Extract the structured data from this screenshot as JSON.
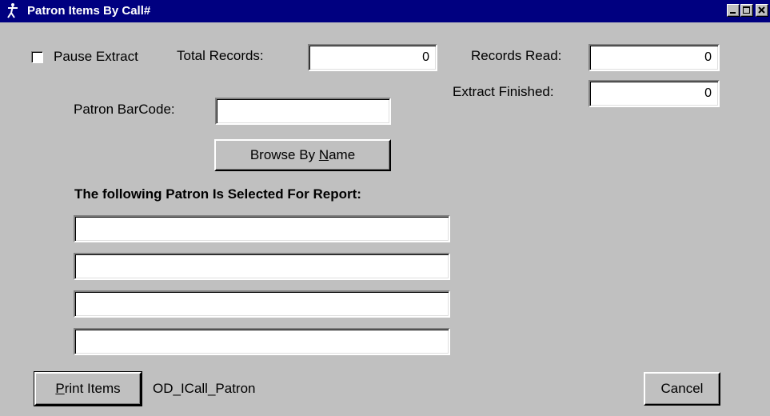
{
  "window": {
    "title": "Patron Items By Call#"
  },
  "extract": {
    "pause_label": "Pause Extract",
    "pause_checked": false,
    "total_records_label": "Total Records:",
    "total_records_value": "0",
    "records_read_label": "Records Read:",
    "records_read_value": "0",
    "extract_finished_label": "Extract Finished:",
    "extract_finished_value": "0"
  },
  "patron": {
    "barcode_label": "Patron BarCode:",
    "barcode_value": "",
    "browse_button": {
      "prefix": "Browse By ",
      "mnemonic": "N",
      "suffix": "ame"
    },
    "selected_heading": "The following Patron Is Selected For Report:",
    "selected_lines": [
      "",
      "",
      "",
      ""
    ]
  },
  "footer": {
    "print_button": {
      "mnemonic": "P",
      "suffix": "rint Items"
    },
    "form_name": "OD_ICall_Patron",
    "cancel_label": "Cancel"
  },
  "icons": {
    "title_icon": "app-figure-icon",
    "minimize": "minimize-icon",
    "maximize": "maximize-icon",
    "close": "close-icon"
  },
  "colors": {
    "titlebar": "#000080",
    "face": "#c0c0c0"
  }
}
